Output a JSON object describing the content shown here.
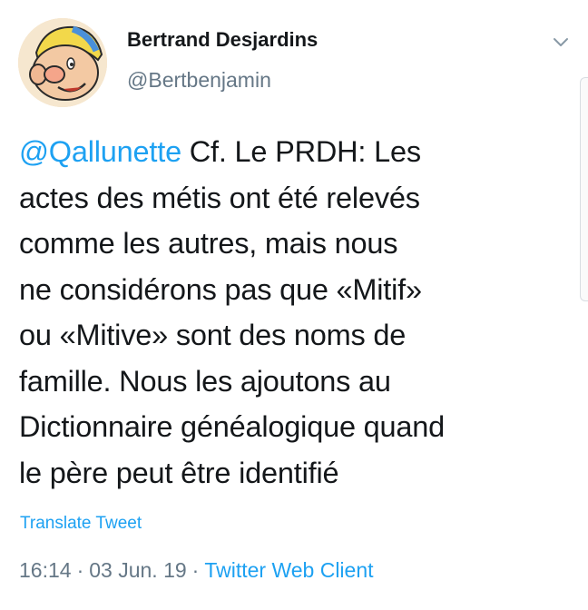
{
  "author": {
    "display_name": "Bertrand Desjardins",
    "handle": "@Bertbenjamin",
    "avatar_icon": "cartoon-character-avatar"
  },
  "menu": {
    "icon": "chevron-down-icon"
  },
  "tweet": {
    "mention": "@Qallunette",
    "lines": [
      " Cf. Le PRDH: Les",
      "actes des métis ont été relevés",
      "comme les autres, mais nous",
      "ne considérons pas que «Mitif»",
      "ou «Mitive» sont des noms de",
      "famille. Nous les ajoutons au",
      "Dictionnaire généalogique quand",
      "le père peut être identifié"
    ],
    "translate_label": "Translate Tweet"
  },
  "meta": {
    "time": "16:14",
    "separator": "·",
    "date": "03 Jun. 19",
    "source": "Twitter Web Client"
  },
  "colors": {
    "link": "#1da1f2",
    "secondary": "#657786",
    "text": "#14171a"
  }
}
